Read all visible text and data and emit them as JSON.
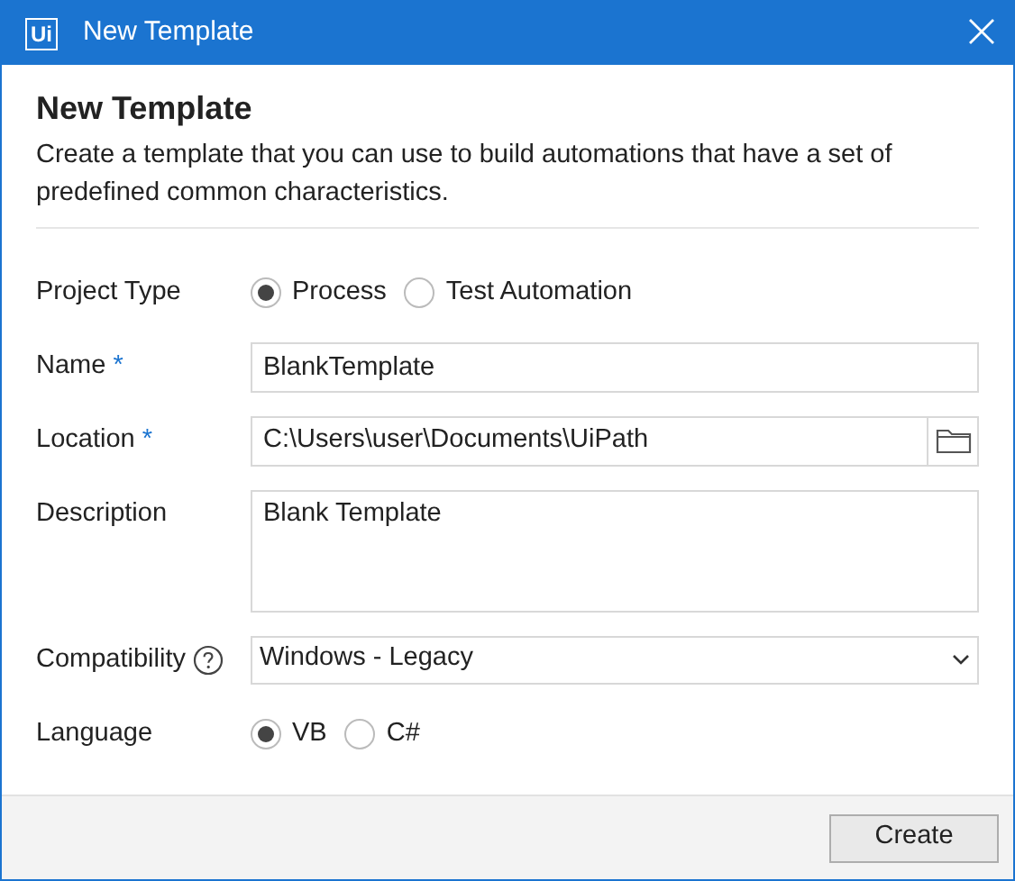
{
  "window": {
    "logo": "Ui",
    "title": "New Template"
  },
  "header": {
    "title": "New Template",
    "description": "Create a template that you can use to build automations that have a set of predefined common characteristics."
  },
  "fields": [
    {
      "kind": "radio",
      "label": "Project Type",
      "help": false,
      "options": [
        {
          "label": "Process",
          "selected": true
        },
        {
          "label": "Test Automation",
          "selected": false
        }
      ]
    },
    {
      "kind": "text",
      "label": "Name",
      "required_mark": "*",
      "help": false,
      "value": "BlankTemplate"
    },
    {
      "kind": "path",
      "label": "Location",
      "required_mark": "*",
      "help": false,
      "value": "C:\\Users\\user\\Documents\\UiPath"
    },
    {
      "kind": "textarea",
      "label": "Description",
      "help": false,
      "value": "Blank Template"
    },
    {
      "kind": "select",
      "label": "Compatibility",
      "help": true,
      "value": "Windows - Legacy"
    },
    {
      "kind": "radio",
      "label": "Language",
      "help": false,
      "options": [
        {
          "label": "VB",
          "selected": true
        },
        {
          "label": "C#",
          "selected": false
        }
      ]
    }
  ],
  "buttons": [
    "Create"
  ]
}
